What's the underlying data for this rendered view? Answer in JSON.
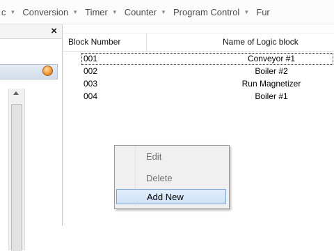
{
  "menubar": {
    "items": [
      {
        "label": "c"
      },
      {
        "label": "Conversion"
      },
      {
        "label": "Timer"
      },
      {
        "label": "Counter"
      },
      {
        "label": "Program Control"
      },
      {
        "label": "Fur"
      }
    ]
  },
  "left_pane": {
    "close_glyph": "×"
  },
  "listview": {
    "columns": {
      "block_number": "Block Number",
      "name": "Name of Logic block"
    },
    "rows": [
      {
        "number": "001",
        "name": "Conveyor #1"
      },
      {
        "number": "002",
        "name": "Boiler #2"
      },
      {
        "number": "003",
        "name": "Run Magnetizer"
      },
      {
        "number": "004",
        "name": "Boiler #1"
      }
    ]
  },
  "context_menu": {
    "edit": "Edit",
    "delete": "Delete",
    "add_new": "Add New"
  },
  "colors": {
    "highlight_border": "#7da2ce",
    "highlight_fill": "#cfe1f6",
    "orb": "#f29a32"
  }
}
